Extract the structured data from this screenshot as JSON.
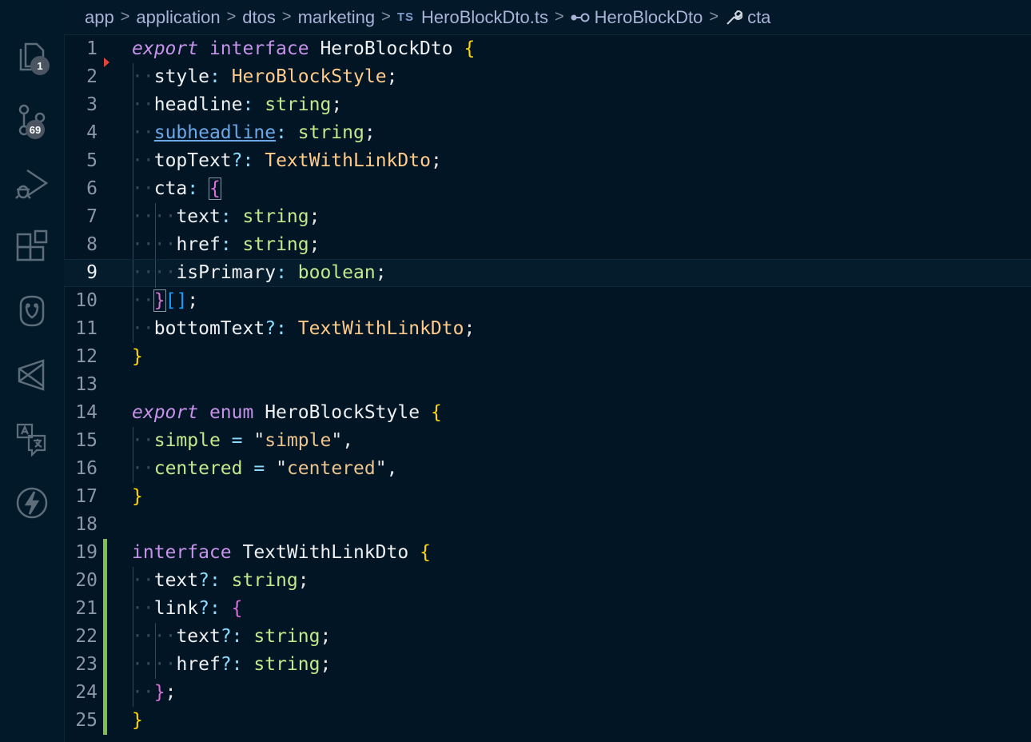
{
  "activity_bar": {
    "explorer_badge": "1",
    "source_control_badge": "69"
  },
  "breadcrumbs": {
    "items": [
      "app",
      "application",
      "dtos",
      "marketing",
      "HeroBlockDto.ts",
      "HeroBlockDto",
      "cta"
    ],
    "ts_label": "TS",
    "separator": ">"
  },
  "editor": {
    "language": "typescript",
    "current_line": 9,
    "line_numbers": [
      "1",
      "2",
      "3",
      "4",
      "5",
      "6",
      "7",
      "8",
      "9",
      "10",
      "11",
      "12",
      "13",
      "14",
      "15",
      "16",
      "17",
      "18",
      "19",
      "20",
      "21",
      "22",
      "23",
      "24",
      "25"
    ],
    "lines": [
      "export interface HeroBlockDto {",
      "  style: HeroBlockStyle;",
      "  headline: string;",
      "  subheadline: string;",
      "  topText?: TextWithLinkDto;",
      "  cta: {",
      "    text: string;",
      "    href: string;",
      "    isPrimary: boolean;",
      "  }[];",
      "  bottomText?: TextWithLinkDto;",
      "}",
      "",
      "export enum HeroBlockStyle {",
      "  simple = \"simple\",",
      "  centered = \"centered\",",
      "}",
      "",
      "interface TextWithLinkDto {",
      "  text?: string;",
      "  link?: {",
      "    text?: string;",
      "    href?: string;",
      "  };",
      "}"
    ],
    "git_added_lines": [
      19,
      20,
      21,
      22,
      23,
      24,
      25
    ]
  },
  "colors": {
    "background": "#021524",
    "keyword": "#c792ea",
    "type": "#ffcb8b",
    "primitive": "#c3e88d",
    "string": "#ecc48d",
    "bracket_level1": "#ffd700",
    "bracket_level2": "#da70d6",
    "bracket_level3": "#179fff",
    "git_added": "#7fbf4e"
  }
}
